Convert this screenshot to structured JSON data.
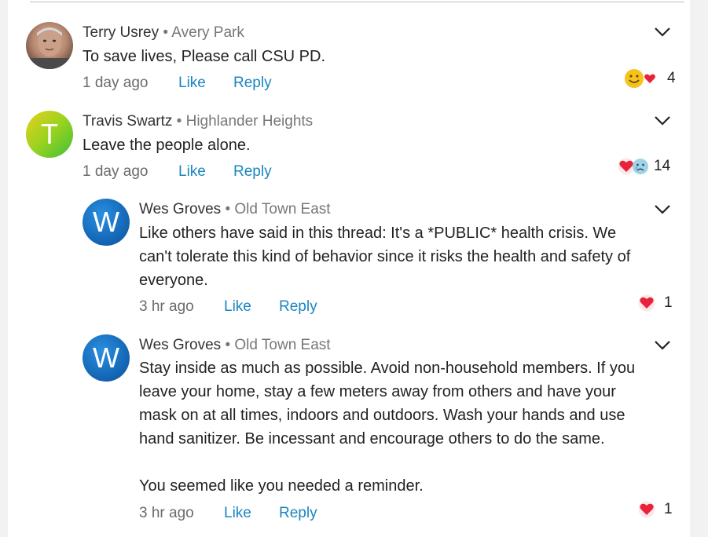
{
  "comments": [
    {
      "name": "Terry Usrey",
      "sep": " • ",
      "location": "Avery Park",
      "text": "To save lives, Please call CSU PD.",
      "time": "1 day ago",
      "like": "Like",
      "reply": "Reply",
      "reaction_count": "4",
      "reaction_icons": [
        "smile-icon",
        "heart-icon"
      ]
    },
    {
      "name": "Travis Swartz",
      "sep": " • ",
      "location": "Highlander Heights",
      "avatar_initial": "T",
      "text": "Leave the people alone.",
      "time": "1 day ago",
      "like": "Like",
      "reply": "Reply",
      "reaction_count": "14",
      "reaction_icons": [
        "heart-icon",
        "sad-icon"
      ]
    },
    {
      "name": "Wes Groves",
      "sep": " • ",
      "location": "Old Town East",
      "avatar_initial": "W",
      "text": "Like others have said in this thread: It's a *PUBLIC* health crisis. We\ncan't tolerate this kind of behavior since it risks the health and safety of\neveryone.",
      "time": "3 hr ago",
      "like": "Like",
      "reply": "Reply",
      "reaction_count": "1",
      "reaction_icons": [
        "heart-icon"
      ]
    },
    {
      "name": "Wes Groves",
      "sep": " • ",
      "location": "Old Town East",
      "avatar_initial": "W",
      "text": "Stay inside as much as possible. Avoid non-household members. If you\nleave your home, stay a few meters away from others and have your\nmask on at all times, indoors and outdoors. Wash your hands and use\nhand sanitizer. Be incessant and encourage others to do the same.\n\nYou seemed like you needed a reminder.",
      "time": "3 hr ago",
      "like": "Like",
      "reply": "Reply",
      "reaction_count": "1",
      "reaction_icons": [
        "heart-icon"
      ]
    }
  ],
  "colors": {
    "link": "#1a86c0",
    "heart": "#e8223a",
    "muted": "#6b6b6b"
  }
}
